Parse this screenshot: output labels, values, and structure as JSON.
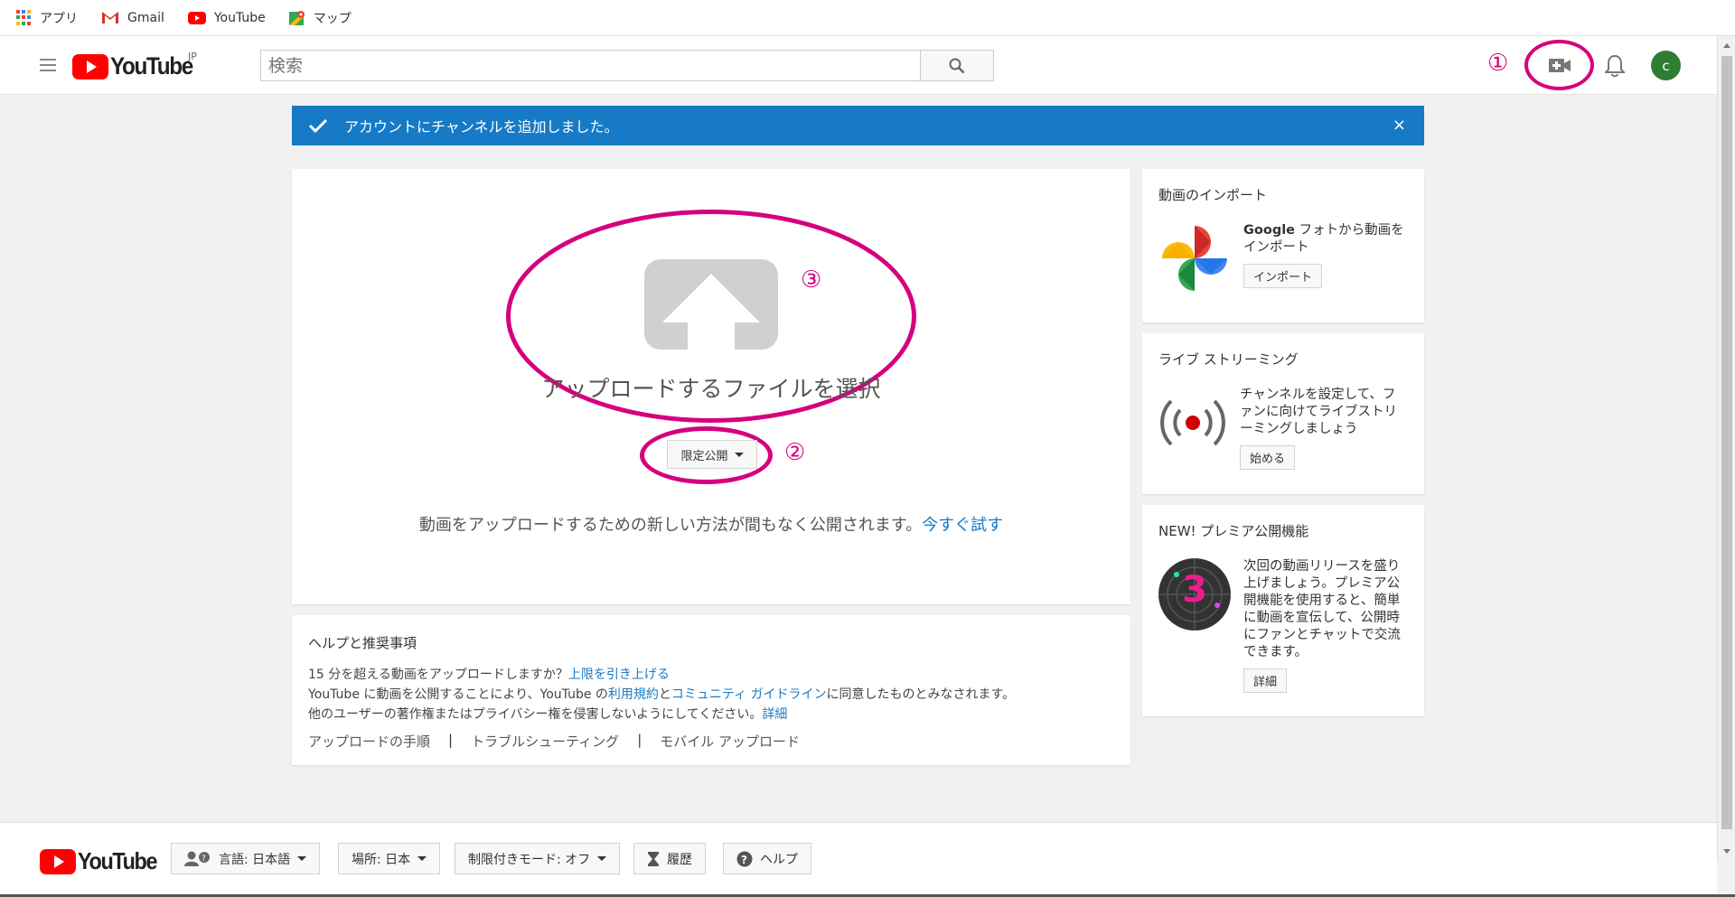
{
  "bookmarks": [
    {
      "label": "アプリ",
      "icon": "apps-grid-icon"
    },
    {
      "label": "Gmail",
      "icon": "gmail-icon"
    },
    {
      "label": "YouTube",
      "icon": "youtube-icon"
    },
    {
      "label": "マップ",
      "icon": "maps-icon"
    }
  ],
  "header": {
    "logo_text": "YouTube",
    "logo_region": "JP",
    "search_placeholder": "検索",
    "avatar_letter": "c"
  },
  "annotations": {
    "one": "①",
    "two": "②",
    "three": "③"
  },
  "banner": {
    "message": "アカウントにチャンネルを追加しました。",
    "close": "×"
  },
  "upload": {
    "title": "アップロードするファイルを選択",
    "privacy": "限定公開",
    "new_method_text": "動画をアップロードするための新しい方法が間もなく公開されます。",
    "try_now": "今すぐ試す"
  },
  "help": {
    "heading": "ヘルプと推奨事項",
    "line1_prefix": "15 分を超える動画をアップロードしますか？",
    "line1_link": "上限を引き上げる",
    "line2_prefix": "YouTube に動画を公開することにより、YouTube の",
    "line2_link1": "利用規約",
    "line2_mid": "と",
    "line2_link2": "コミュニティ ガイドライン",
    "line2_suffix": "に同意したものとみなされます。",
    "line3_prefix": "他のユーザーの著作権またはプライバシー権を侵害しないようにしてください。",
    "line3_link": "詳細",
    "links": [
      "アップロードの手順",
      "トラブルシューティング",
      "モバイル アップロード"
    ],
    "separator": "|"
  },
  "side": {
    "import": {
      "title": "動画のインポート",
      "text_bold": "Google",
      "text": " フォトから動画をインポート",
      "button": "インポート"
    },
    "live": {
      "title": "ライブ ストリーミング",
      "text": "チャンネルを設定して、ファンに向けてライブストリーミングしましょう",
      "button": "始める"
    },
    "premiere": {
      "title": "NEW! プレミア公開機能",
      "badge": "3",
      "text": "次回の動画リリースを盛り上げましょう。プレミア公開機能を使用すると、簡単に動画を宣伝して、公開時にファンとチャットで交流できます。",
      "button": "詳細"
    }
  },
  "footer": {
    "logo_text": "YouTube",
    "language": "言語: 日本語",
    "location": "場所: 日本",
    "restricted": "制限付きモード: オフ",
    "history": "履歴",
    "help": "ヘルプ"
  },
  "colors": {
    "accent": "#167ac6",
    "annotation": "#d5007f",
    "brand_red": "#ff0000"
  }
}
